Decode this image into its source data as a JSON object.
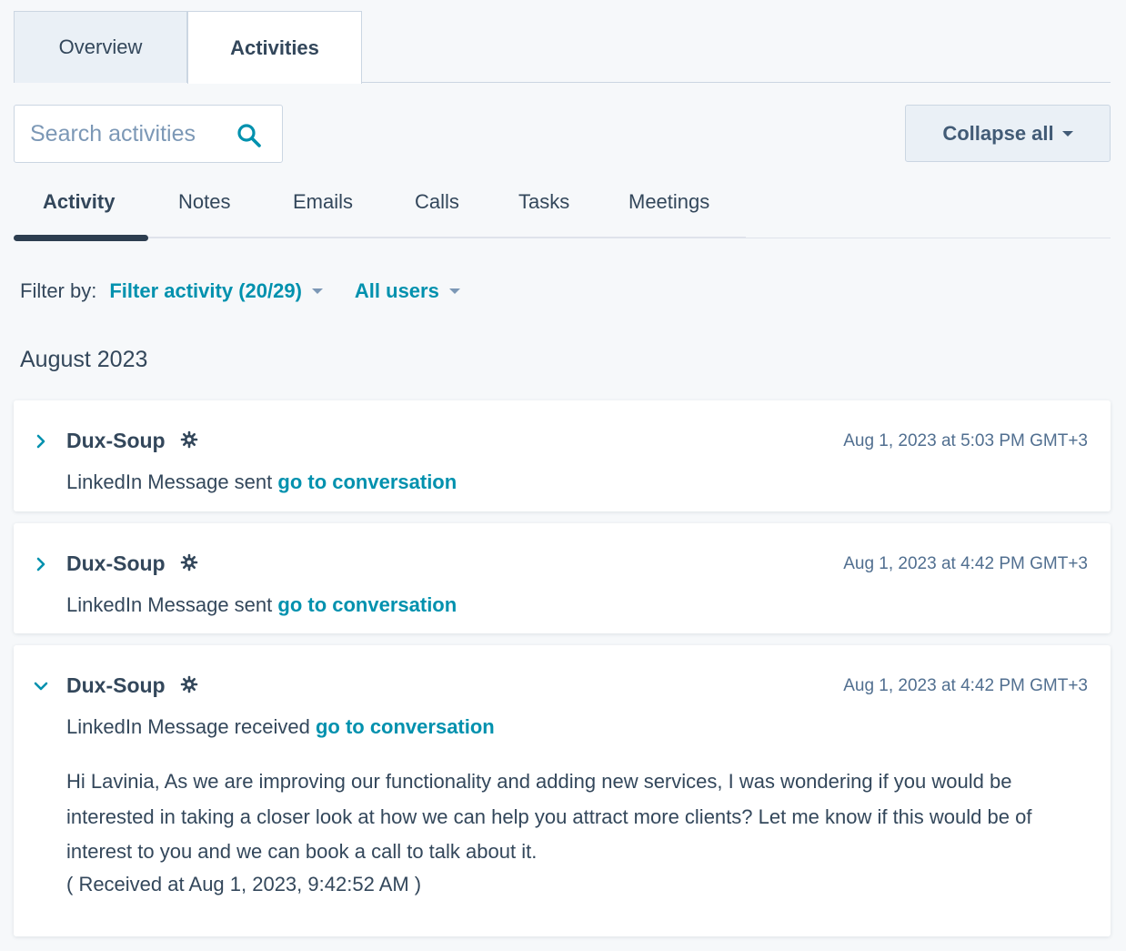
{
  "top_tabs": {
    "overview": "Overview",
    "activities": "Activities"
  },
  "search": {
    "placeholder": "Search activities"
  },
  "collapse_button": {
    "label": "Collapse all"
  },
  "sub_tabs": {
    "activity": "Activity",
    "notes": "Notes",
    "emails": "Emails",
    "calls": "Calls",
    "tasks": "Tasks",
    "meetings": "Meetings"
  },
  "filter": {
    "label": "Filter by:",
    "activity": "Filter activity (20/29)",
    "users": "All users"
  },
  "month": "August 2023",
  "activities": [
    {
      "author": "Dux-Soup",
      "timestamp": "Aug 1, 2023 at 5:03 PM GMT+3",
      "subject_text": "LinkedIn Message sent",
      "link_text": "go to conversation",
      "expanded": false
    },
    {
      "author": "Dux-Soup",
      "timestamp": "Aug 1, 2023 at 4:42 PM GMT+3",
      "subject_text": "LinkedIn Message sent",
      "link_text": "go to conversation",
      "expanded": false
    },
    {
      "author": "Dux-Soup",
      "timestamp": "Aug 1, 2023 at 4:42 PM GMT+3",
      "subject_text": "LinkedIn Message received",
      "link_text": "go to conversation",
      "expanded": true,
      "body": "Hi Lavinia, As we are improving our functionality and adding new services, I was wondering if you would be interested in taking a closer look at how we can help you attract more clients? Let me know if this would be of interest to you and we can book a call to talk about it.",
      "received": "( Received at Aug 1, 2023, 9:42:52 AM )"
    }
  ],
  "colors": {
    "link": "#0091ae",
    "text": "#33475b",
    "muted": "#516f90",
    "tab_inactive_bg": "#eaf0f6",
    "indicator": "#2d3e50"
  },
  "icons": [
    "search-icon",
    "chevron-right-icon",
    "chevron-down-icon",
    "gear-icon",
    "caret-down-icon"
  ]
}
